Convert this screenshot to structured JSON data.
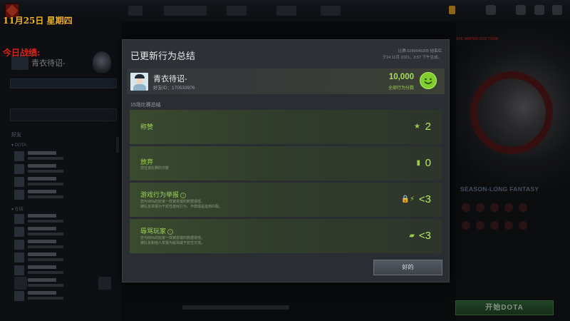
{
  "overlay": {
    "date": "11月25日 星期四",
    "today_label": "今日战绩:"
  },
  "background": {
    "profile_name": "青衣待诏-",
    "start_button": "开始DOTA",
    "event_title": "SEASON-LONG FANTASY",
    "event_banner": "SPE WINTER 2022 TOUR"
  },
  "modal": {
    "title": "已更新行为总结",
    "match_id": "比赛 6289646305 结束后",
    "match_date": "于24 11月 2021，3:57 下午生成。",
    "player": {
      "name": "青衣待诏-",
      "friend_id": "好友ID：170533976",
      "score": "10,000",
      "score_label": "全部行为分数"
    },
    "section_label": "15场比赛总结",
    "rows": [
      {
        "title": "称赞",
        "desc": [],
        "icon": "star-icon",
        "value": "2"
      },
      {
        "title": "放弃",
        "desc": [
          "您在该比赛的次数"
        ],
        "icon": "abandon-icon",
        "value": "0"
      },
      {
        "title": "游戏行为举报",
        "desc": [
          "您与98%的玩家一样被举报的数据很低。",
          "被队友举报为干扰性游戏行为，作弊或是滥用匹配。"
        ],
        "icon": "lock-bolt-icon",
        "value": "<3"
      },
      {
        "title": "辱骂玩家",
        "desc": [
          "您与85%的玩家一样被举报的数据很低。",
          "被队友和他人举报为辱骂或干扰性交流。"
        ],
        "icon": "chat-icon",
        "value": "<3"
      }
    ],
    "ok_button": "好的"
  },
  "colors": {
    "accent_green": "#a6e155",
    "date_yellow": "#f0b429",
    "today_red": "#e0261b"
  }
}
